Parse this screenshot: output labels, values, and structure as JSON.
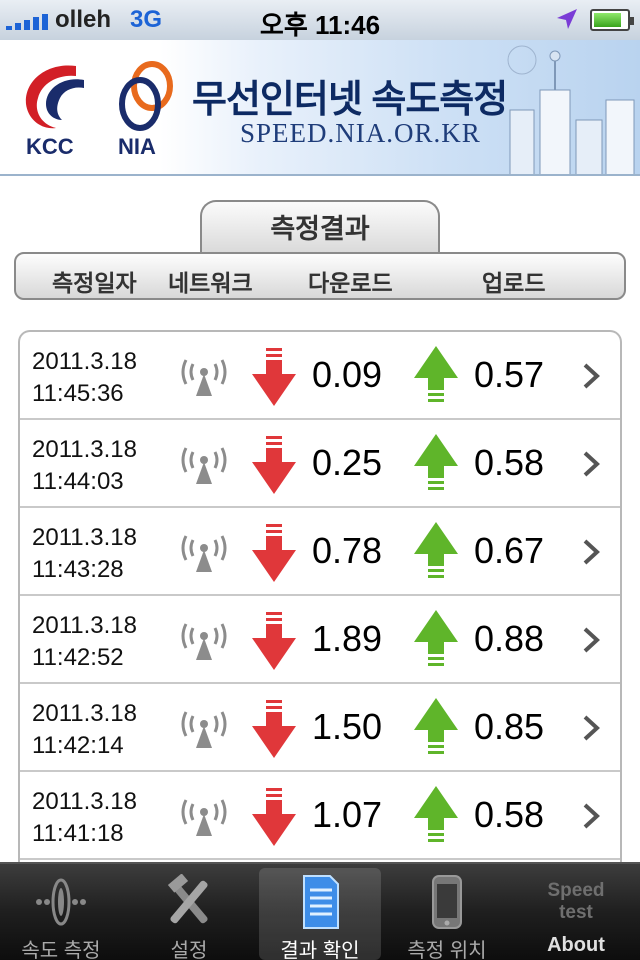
{
  "status_bar": {
    "carrier": "olleh",
    "network": "3G",
    "time": "오후 11:46",
    "battery_level": 0.85
  },
  "banner": {
    "kcc_label": "KCC",
    "nia_label": "NIA",
    "title": "무선인터넷 속도측정",
    "url": "SPEED.NIA.OR.KR"
  },
  "results": {
    "tab_title": "측정결과",
    "columns": [
      "측정일자",
      "네트워크",
      "다운로드",
      "업로드"
    ]
  },
  "rows": [
    {
      "date": "2011.3.18",
      "time": "11:45:36",
      "download": "0.09",
      "upload": "0.57",
      "network_icon": "wifi-icon"
    },
    {
      "date": "2011.3.18",
      "time": "11:44:03",
      "download": "0.25",
      "upload": "0.58",
      "network_icon": "wifi-icon"
    },
    {
      "date": "2011.3.18",
      "time": "11:43:28",
      "download": "0.78",
      "upload": "0.67",
      "network_icon": "wifi-icon"
    },
    {
      "date": "2011.3.18",
      "time": "11:42:52",
      "download": "1.89",
      "upload": "0.88",
      "network_icon": "wifi-icon"
    },
    {
      "date": "2011.3.18",
      "time": "11:42:14",
      "download": "1.50",
      "upload": "0.85",
      "network_icon": "wifi-icon"
    },
    {
      "date": "2011.3.18",
      "time": "11:41:18",
      "download": "1.07",
      "upload": "0.58",
      "network_icon": "wifi-icon"
    }
  ],
  "tabbar": {
    "tabs": [
      {
        "label": "속도 측정",
        "icon": "speedometer-icon"
      },
      {
        "label": "설정",
        "icon": "tools-icon"
      },
      {
        "label": "결과 확인",
        "icon": "document-icon",
        "active": true
      },
      {
        "label": "측정 위치",
        "icon": "phone-icon"
      },
      {
        "label": "About",
        "icon": "speedtest-logo",
        "logo_line1": "Speed",
        "logo_line2": "test"
      }
    ]
  },
  "colors": {
    "download_arrow": "#e0373a",
    "upload_arrow": "#5fb52a",
    "status_blue": "#1c63d6",
    "tabbar_bg": "#1f1f1f"
  }
}
